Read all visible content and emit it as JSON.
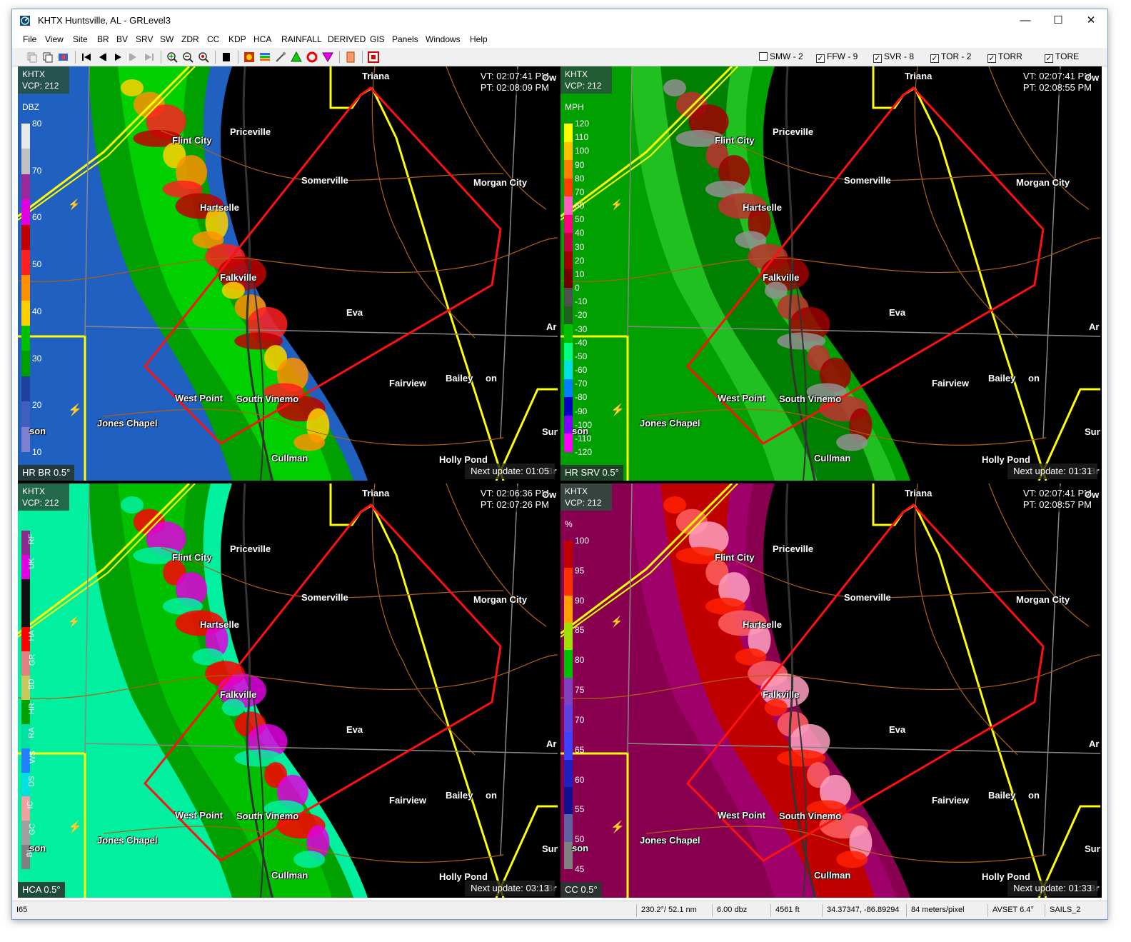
{
  "window": {
    "title": "KHTX Huntsville, AL - GRLevel3",
    "minimize": "—",
    "maximize": "☐",
    "close": "✕"
  },
  "menu": [
    "File",
    "View",
    "Site",
    "BR",
    "BV",
    "SRV",
    "SW",
    "ZDR",
    "CC",
    "KDP",
    "HCA",
    "RAINFALL",
    "DERIVED",
    "GIS",
    "Panels",
    "Windows",
    "Help"
  ],
  "warnings": [
    {
      "label": "SMW - 2",
      "checked": false
    },
    {
      "label": "FFW - 9",
      "checked": true
    },
    {
      "label": "SVR - 8",
      "checked": true
    },
    {
      "label": "TOR - 2",
      "checked": true
    },
    {
      "label": "TORR",
      "checked": true
    },
    {
      "label": "TORE",
      "checked": true
    }
  ],
  "cities": [
    "Triana",
    "Flint City",
    "Priceville",
    "Somerville",
    "Morgan City",
    "Hartselle",
    "Falkville",
    "Eva",
    "Fairview",
    "Bailey",
    "on",
    "West Point",
    "South Vinemo",
    "Jones Chapel",
    "Cullman",
    "Holly Pond",
    "son",
    "Sun",
    "Ar",
    "Ow",
    "Br"
  ],
  "panels": [
    {
      "site": "KHTX",
      "vcp": "VCP: 212",
      "vt": "VT: 02:07:41 PM",
      "pt": "PT: 02:08:09 PM",
      "product": "HR BR 0.5°",
      "next": "Next update: 01:05",
      "unit": "DBZ",
      "scale": [
        "80",
        "70",
        "60",
        "50",
        "40",
        "30",
        "20",
        "10"
      ]
    },
    {
      "site": "KHTX",
      "vcp": "VCP: 212",
      "vt": "VT: 02:07:41 PM",
      "pt": "PT: 02:08:55 PM",
      "product": "HR SRV 0.5°",
      "next": "Next update: 01:31",
      "unit": "MPH",
      "scale": [
        "120",
        "110",
        "100",
        "90",
        "80",
        "70",
        "60",
        "50",
        "40",
        "30",
        "20",
        "10",
        "0",
        "-10",
        "-20",
        "-30",
        "-40",
        "-50",
        "-60",
        "-70",
        "-80",
        "-90",
        "-100",
        "-110",
        "-120"
      ]
    },
    {
      "site": "KHTX",
      "vcp": "VCP: 212",
      "vt": "VT: 02:06:36 PM",
      "pt": "PT: 02:07:26 PM",
      "product": "HCA 0.5°",
      "next": "Next update: 03:13",
      "unit": "",
      "scale": [
        "RF",
        "UK",
        "",
        "",
        "HA",
        "GR",
        "BD",
        "HR",
        "RA",
        "WS",
        "DS",
        "IC",
        "GC",
        "BI"
      ]
    },
    {
      "site": "KHTX",
      "vcp": "VCP: 212",
      "vt": "VT: 02:07:41 PM",
      "pt": "PT: 02:08:57 PM",
      "product": "CC 0.5°",
      "next": "Next update: 01:33",
      "unit": "%",
      "scale": [
        "100",
        "95",
        "90",
        "85",
        "80",
        "75",
        "70",
        "65",
        "60",
        "55",
        "50",
        "45"
      ]
    }
  ],
  "status": {
    "road": "I65",
    "azimuth": "230.2°/ 52.1 nm",
    "value": "6.00 dbz",
    "height": "4561 ft",
    "latlon": "34.37347, -86.89294",
    "res": "84 meters/pixel",
    "avset": "AVSET 6.4°",
    "sails": "SAILS_2"
  },
  "colors": {
    "warning_polygon": "#ff1010",
    "county_line": "#ffff00",
    "road": "#c07000",
    "border": "#8a8a8a"
  }
}
